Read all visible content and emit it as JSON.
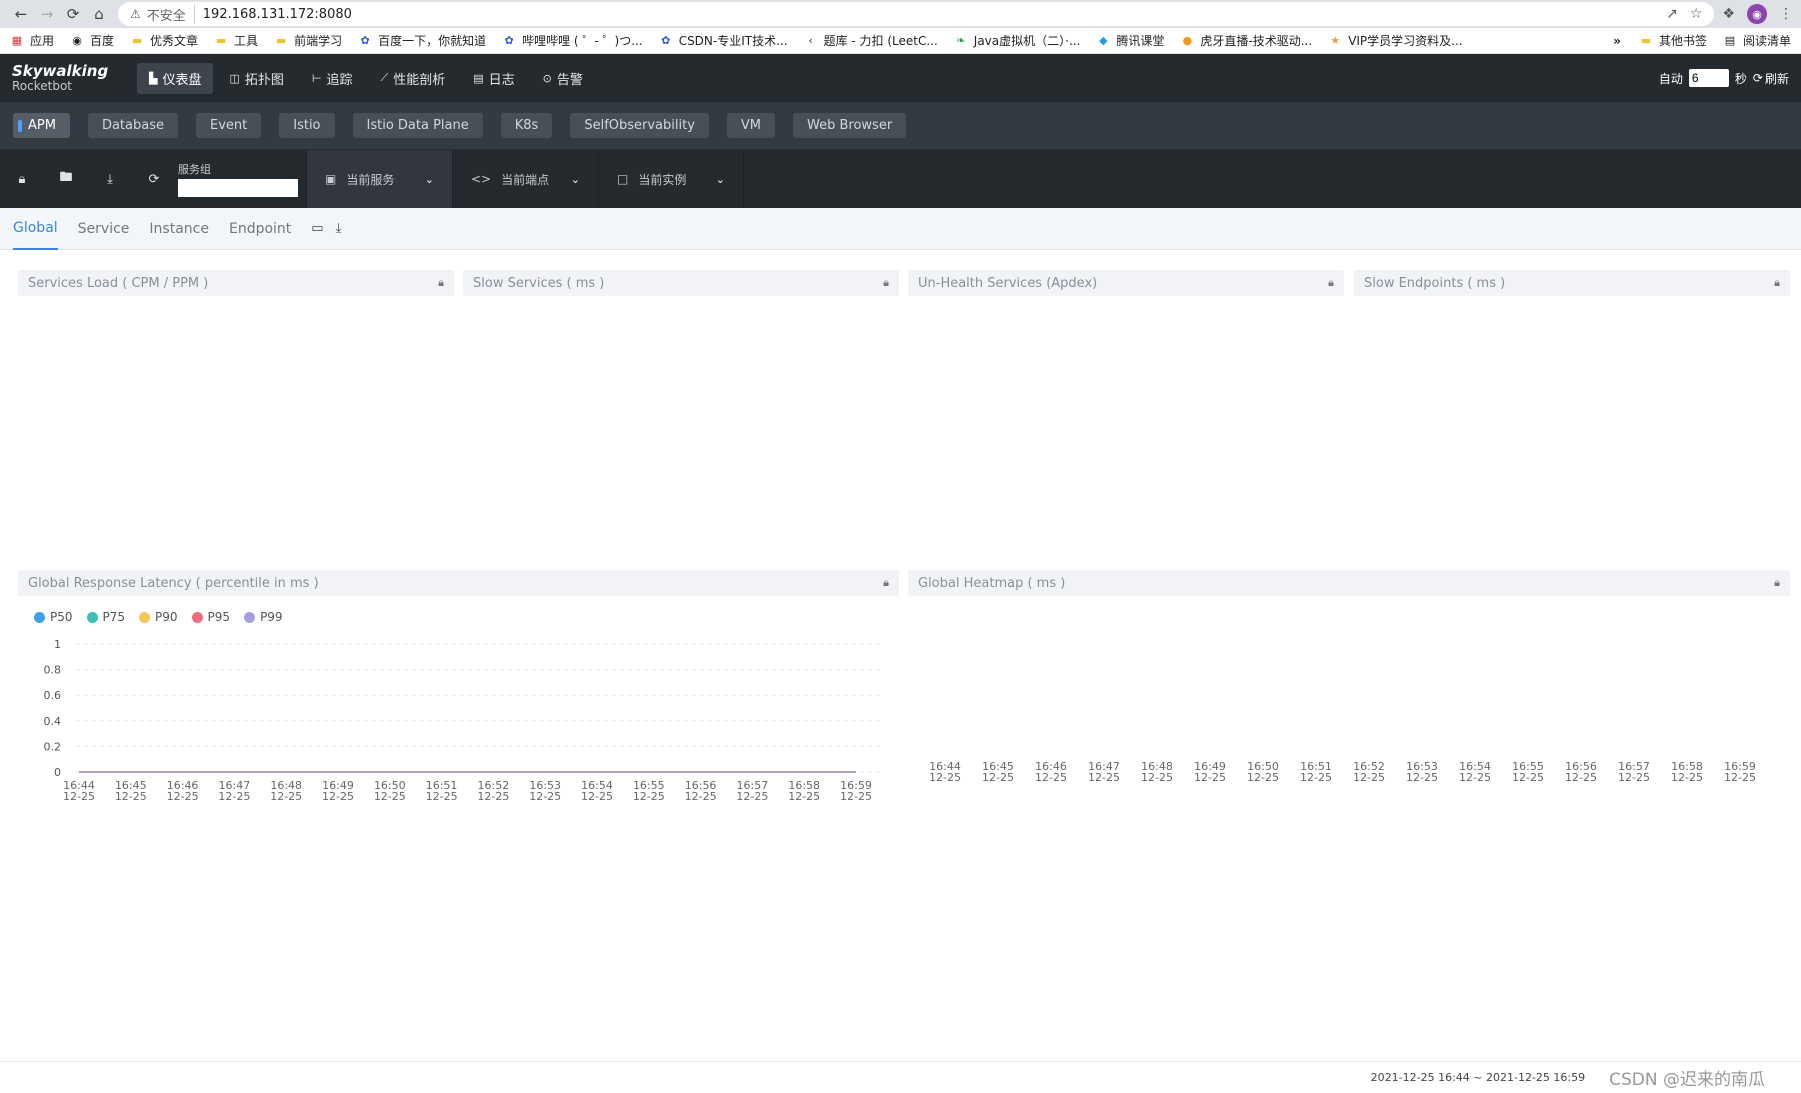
{
  "browser": {
    "insecure_label": "不安全",
    "url": "192.168.131.172:8080",
    "bookmarks": [
      {
        "icon": "apps-icon",
        "label": "应用"
      },
      {
        "icon": "baidu-icon",
        "label": "百度"
      },
      {
        "icon": "folder-icon",
        "label": "优秀文章"
      },
      {
        "icon": "folder-icon",
        "label": "工具"
      },
      {
        "icon": "folder-icon",
        "label": "前端学习"
      },
      {
        "icon": "paw-icon",
        "label": "百度一下，你就知道"
      },
      {
        "icon": "paw-icon",
        "label": "哔哩哔哩 ( ゜- ゜)つ..."
      },
      {
        "icon": "paw-icon",
        "label": "CSDN-专业IT技术..."
      },
      {
        "icon": "leetcode-icon",
        "label": "题库 - 力扣 (LeetC..."
      },
      {
        "icon": "leaf-icon",
        "label": "Java虚拟机（二）·..."
      },
      {
        "icon": "tencent-icon",
        "label": "腾讯课堂"
      },
      {
        "icon": "huya-icon",
        "label": "虎牙直播-技术驱动..."
      },
      {
        "icon": "vip-icon",
        "label": "VIP学员学习资料及..."
      }
    ],
    "more": "»",
    "other_bookmarks": "其他书签",
    "reading_list": "阅读清单"
  },
  "app": {
    "logo_line1": "Skywalking",
    "logo_line2": "Rocketbot",
    "nav": [
      {
        "label": "仪表盘",
        "icon": "dashboard-icon",
        "active": true
      },
      {
        "label": "拓扑图",
        "icon": "topology-icon",
        "active": false
      },
      {
        "label": "追踪",
        "icon": "trace-icon",
        "active": false
      },
      {
        "label": "性能剖析",
        "icon": "profile-icon",
        "active": false
      },
      {
        "label": "日志",
        "icon": "log-icon",
        "active": false
      },
      {
        "label": "告警",
        "icon": "alarm-icon",
        "active": false
      }
    ],
    "auto_label": "自动",
    "auto_value": "6",
    "seconds_label": "秒",
    "refresh_label": "刷新"
  },
  "layers": [
    "APM",
    "Database",
    "Event",
    "Istio",
    "Istio Data Plane",
    "K8s",
    "SelfObservability",
    "VM",
    "Web Browser"
  ],
  "toolbar": {
    "group_label": "服务组",
    "group_value": "",
    "current_service": "当前服务",
    "current_endpoint": "当前端点",
    "current_instance": "当前实例"
  },
  "sub_tabs": [
    "Global",
    "Service",
    "Instance",
    "Endpoint"
  ],
  "panels": {
    "services_load": "Services Load ( CPM / PPM )",
    "slow_services": "Slow Services ( ms )",
    "unhealth_services": "Un-Health Services (Apdex)",
    "slow_endpoints": "Slow Endpoints ( ms )",
    "global_latency": "Global Response Latency ( percentile in ms )",
    "global_heatmap": "Global Heatmap ( ms )"
  },
  "chart_data": [
    {
      "type": "line",
      "title": "Global Response Latency ( percentile in ms )",
      "x": [
        "16:44\n12-25",
        "16:45\n12-25",
        "16:46\n12-25",
        "16:47\n12-25",
        "16:48\n12-25",
        "16:49\n12-25",
        "16:50\n12-25",
        "16:51\n12-25",
        "16:52\n12-25",
        "16:53\n12-25",
        "16:54\n12-25",
        "16:55\n12-25",
        "16:56\n12-25",
        "16:57\n12-25",
        "16:58\n12-25",
        "16:59\n12-25"
      ],
      "ylim": [
        0,
        1
      ],
      "yticks": [
        "0",
        "0.2",
        "0.4",
        "0.6",
        "0.8",
        "1"
      ],
      "legend_position": "top-left",
      "series": [
        {
          "name": "P50",
          "color": "#3fa0ea",
          "values": [
            0,
            0,
            0,
            0,
            0,
            0,
            0,
            0,
            0,
            0,
            0,
            0,
            0,
            0,
            0,
            0
          ]
        },
        {
          "name": "P75",
          "color": "#3cc0b5",
          "values": [
            0,
            0,
            0,
            0,
            0,
            0,
            0,
            0,
            0,
            0,
            0,
            0,
            0,
            0,
            0,
            0
          ]
        },
        {
          "name": "P90",
          "color": "#f5c754",
          "values": [
            0,
            0,
            0,
            0,
            0,
            0,
            0,
            0,
            0,
            0,
            0,
            0,
            0,
            0,
            0,
            0
          ]
        },
        {
          "name": "P95",
          "color": "#ef6b7d",
          "values": [
            0,
            0,
            0,
            0,
            0,
            0,
            0,
            0,
            0,
            0,
            0,
            0,
            0,
            0,
            0,
            0
          ]
        },
        {
          "name": "P99",
          "color": "#a39ee0",
          "values": [
            0,
            0,
            0,
            0,
            0,
            0,
            0,
            0,
            0,
            0,
            0,
            0,
            0,
            0,
            0,
            0
          ]
        }
      ]
    },
    {
      "type": "heatmap",
      "title": "Global Heatmap ( ms )",
      "x": [
        "16:44\n12-25",
        "16:45\n12-25",
        "16:46\n12-25",
        "16:47\n12-25",
        "16:48\n12-25",
        "16:49\n12-25",
        "16:50\n12-25",
        "16:51\n12-25",
        "16:52\n12-25",
        "16:53\n12-25",
        "16:54\n12-25",
        "16:55\n12-25",
        "16:56\n12-25",
        "16:57\n12-25",
        "16:58\n12-25",
        "16:59\n12-25"
      ],
      "values": []
    }
  ],
  "footer": {
    "time_range": "2021-12-25 16:44 ~ 2021-12-25 16:59",
    "watermark": "CSDN @迟来的南瓜"
  }
}
